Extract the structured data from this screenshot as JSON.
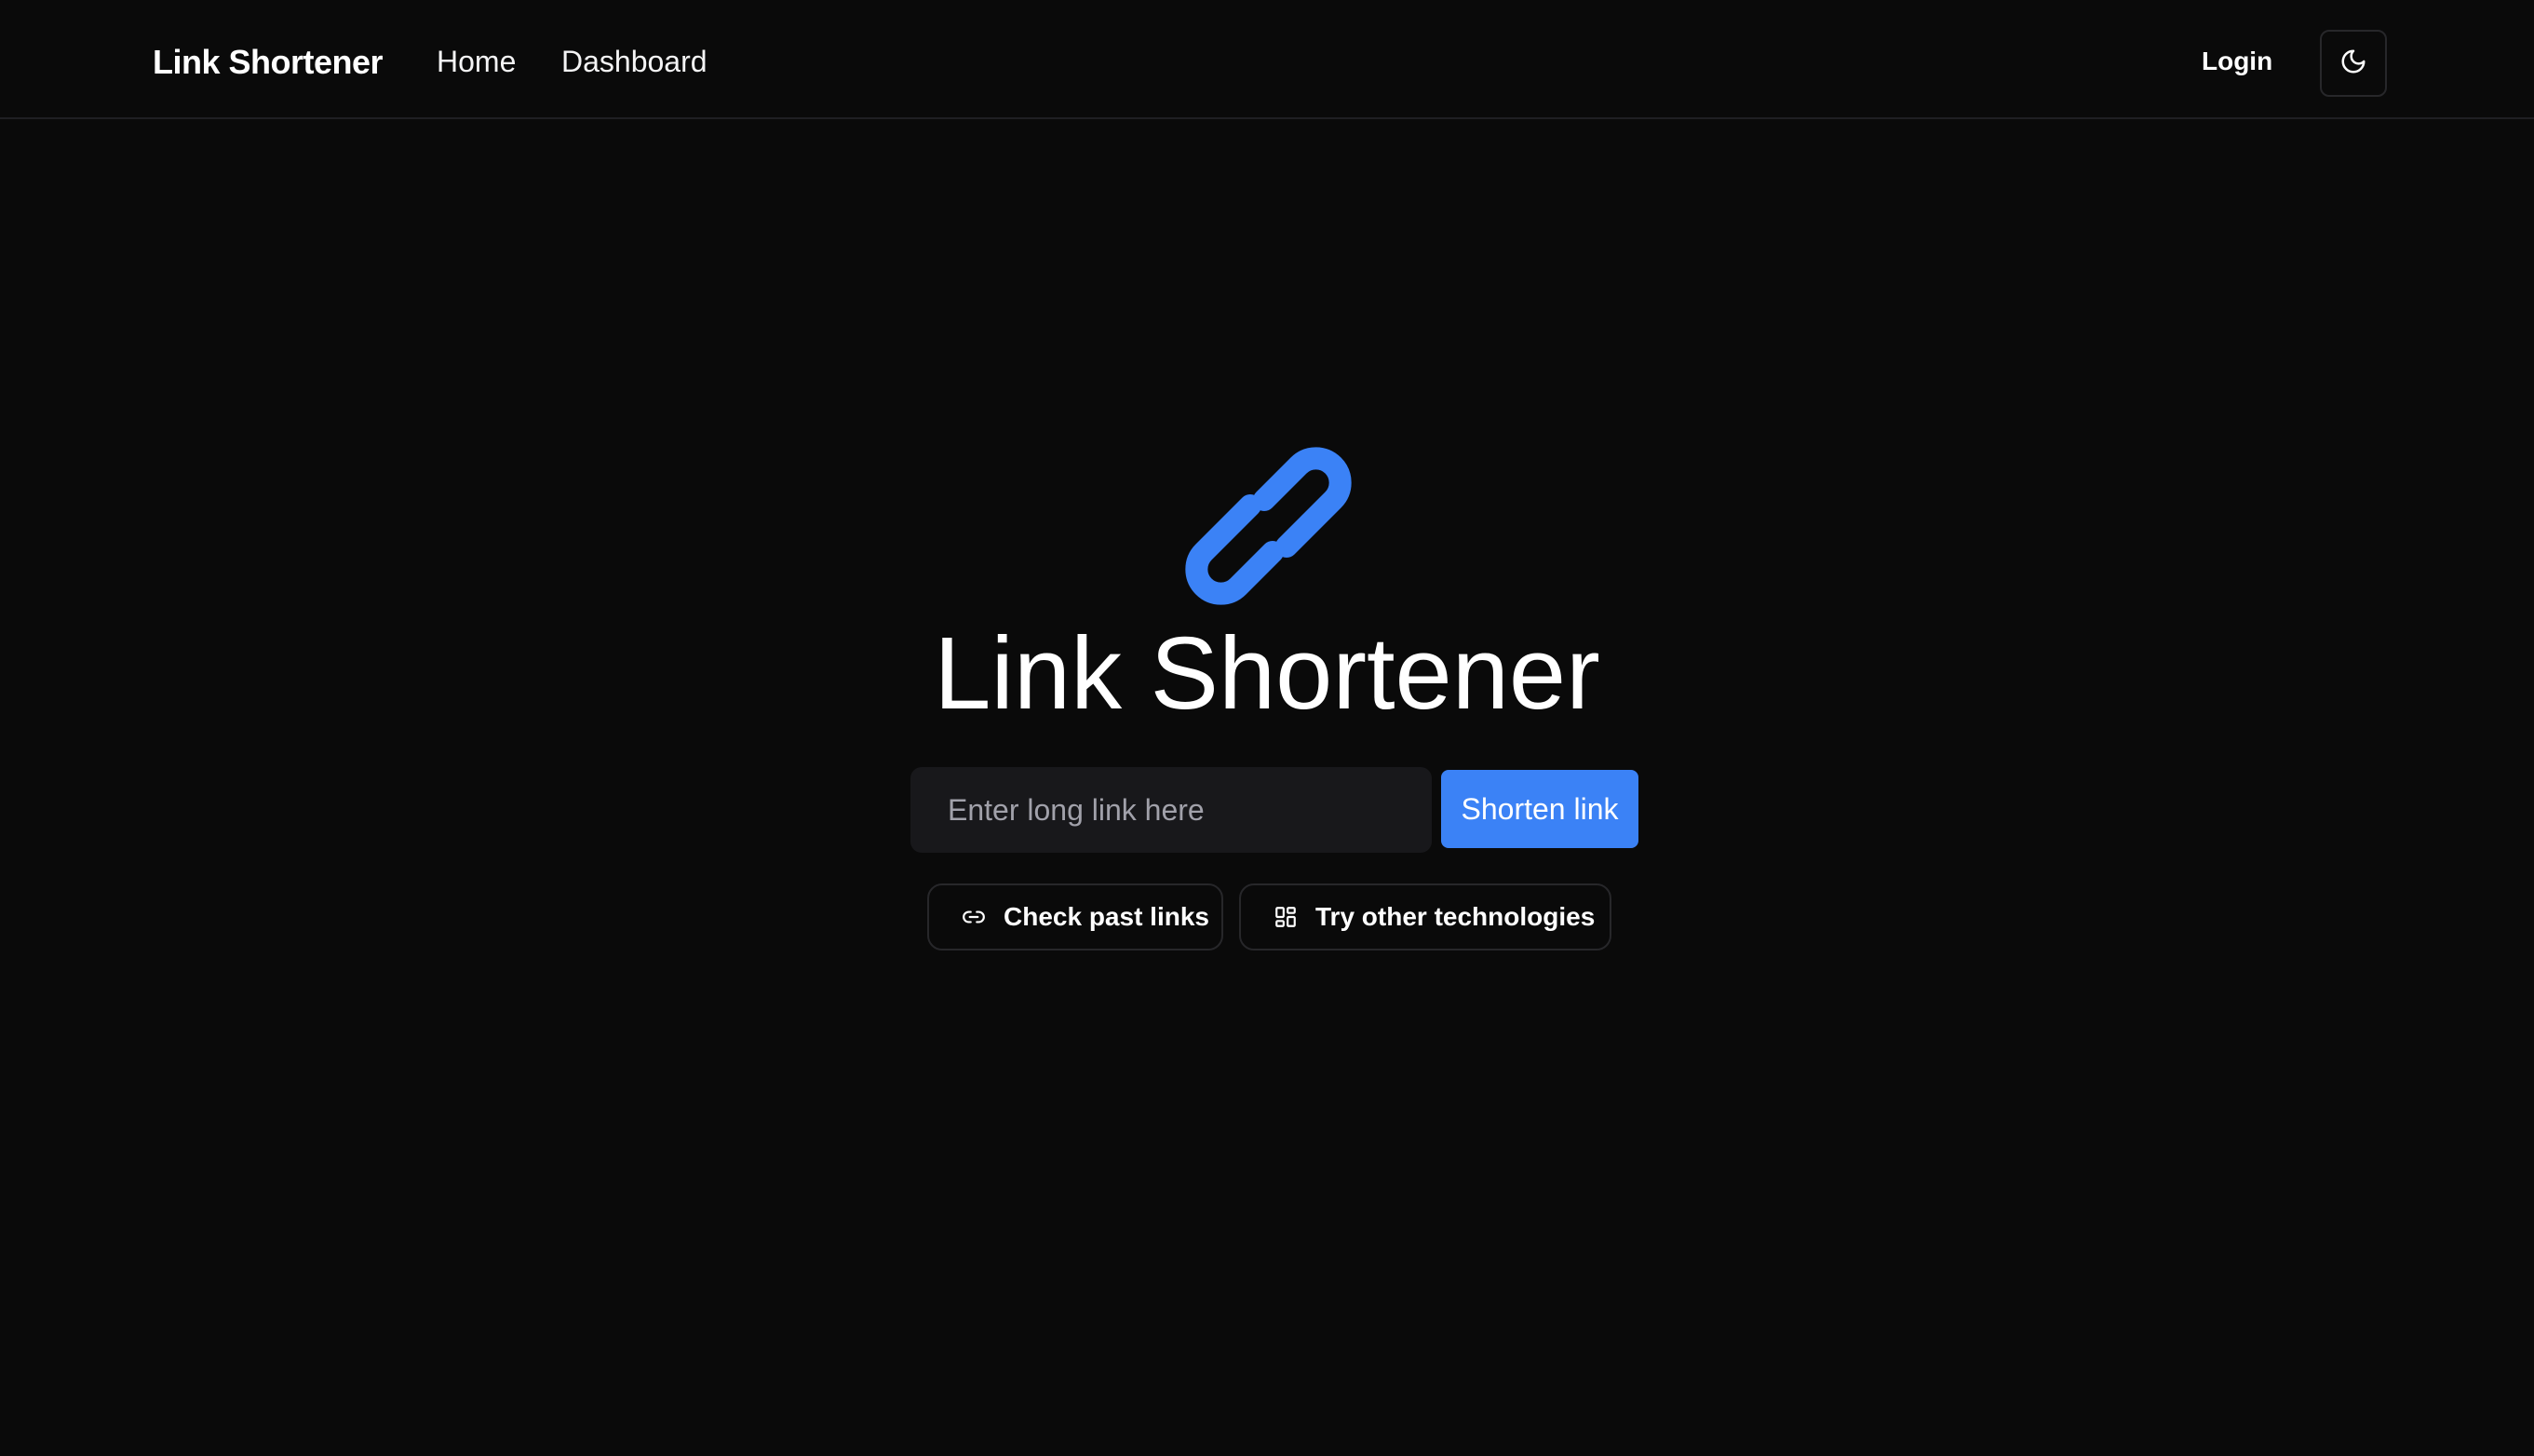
{
  "header": {
    "brand": "Link Shortener",
    "nav": [
      {
        "label": "Home"
      },
      {
        "label": "Dashboard"
      }
    ],
    "login_label": "Login",
    "theme_toggle_icon": "moon-icon"
  },
  "hero": {
    "icon": "link-icon",
    "title": "Link Shortener",
    "input": {
      "placeholder": "Enter long link here",
      "value": ""
    },
    "submit_label": "Shorten link",
    "actions": [
      {
        "label": "Check past links",
        "icon": "link-icon"
      },
      {
        "label": "Try other technologies",
        "icon": "grid-icon"
      }
    ]
  },
  "colors": {
    "background": "#0a0a0a",
    "accent": "#3b82f6",
    "input_bg": "#18181b",
    "border": "#27272a"
  }
}
